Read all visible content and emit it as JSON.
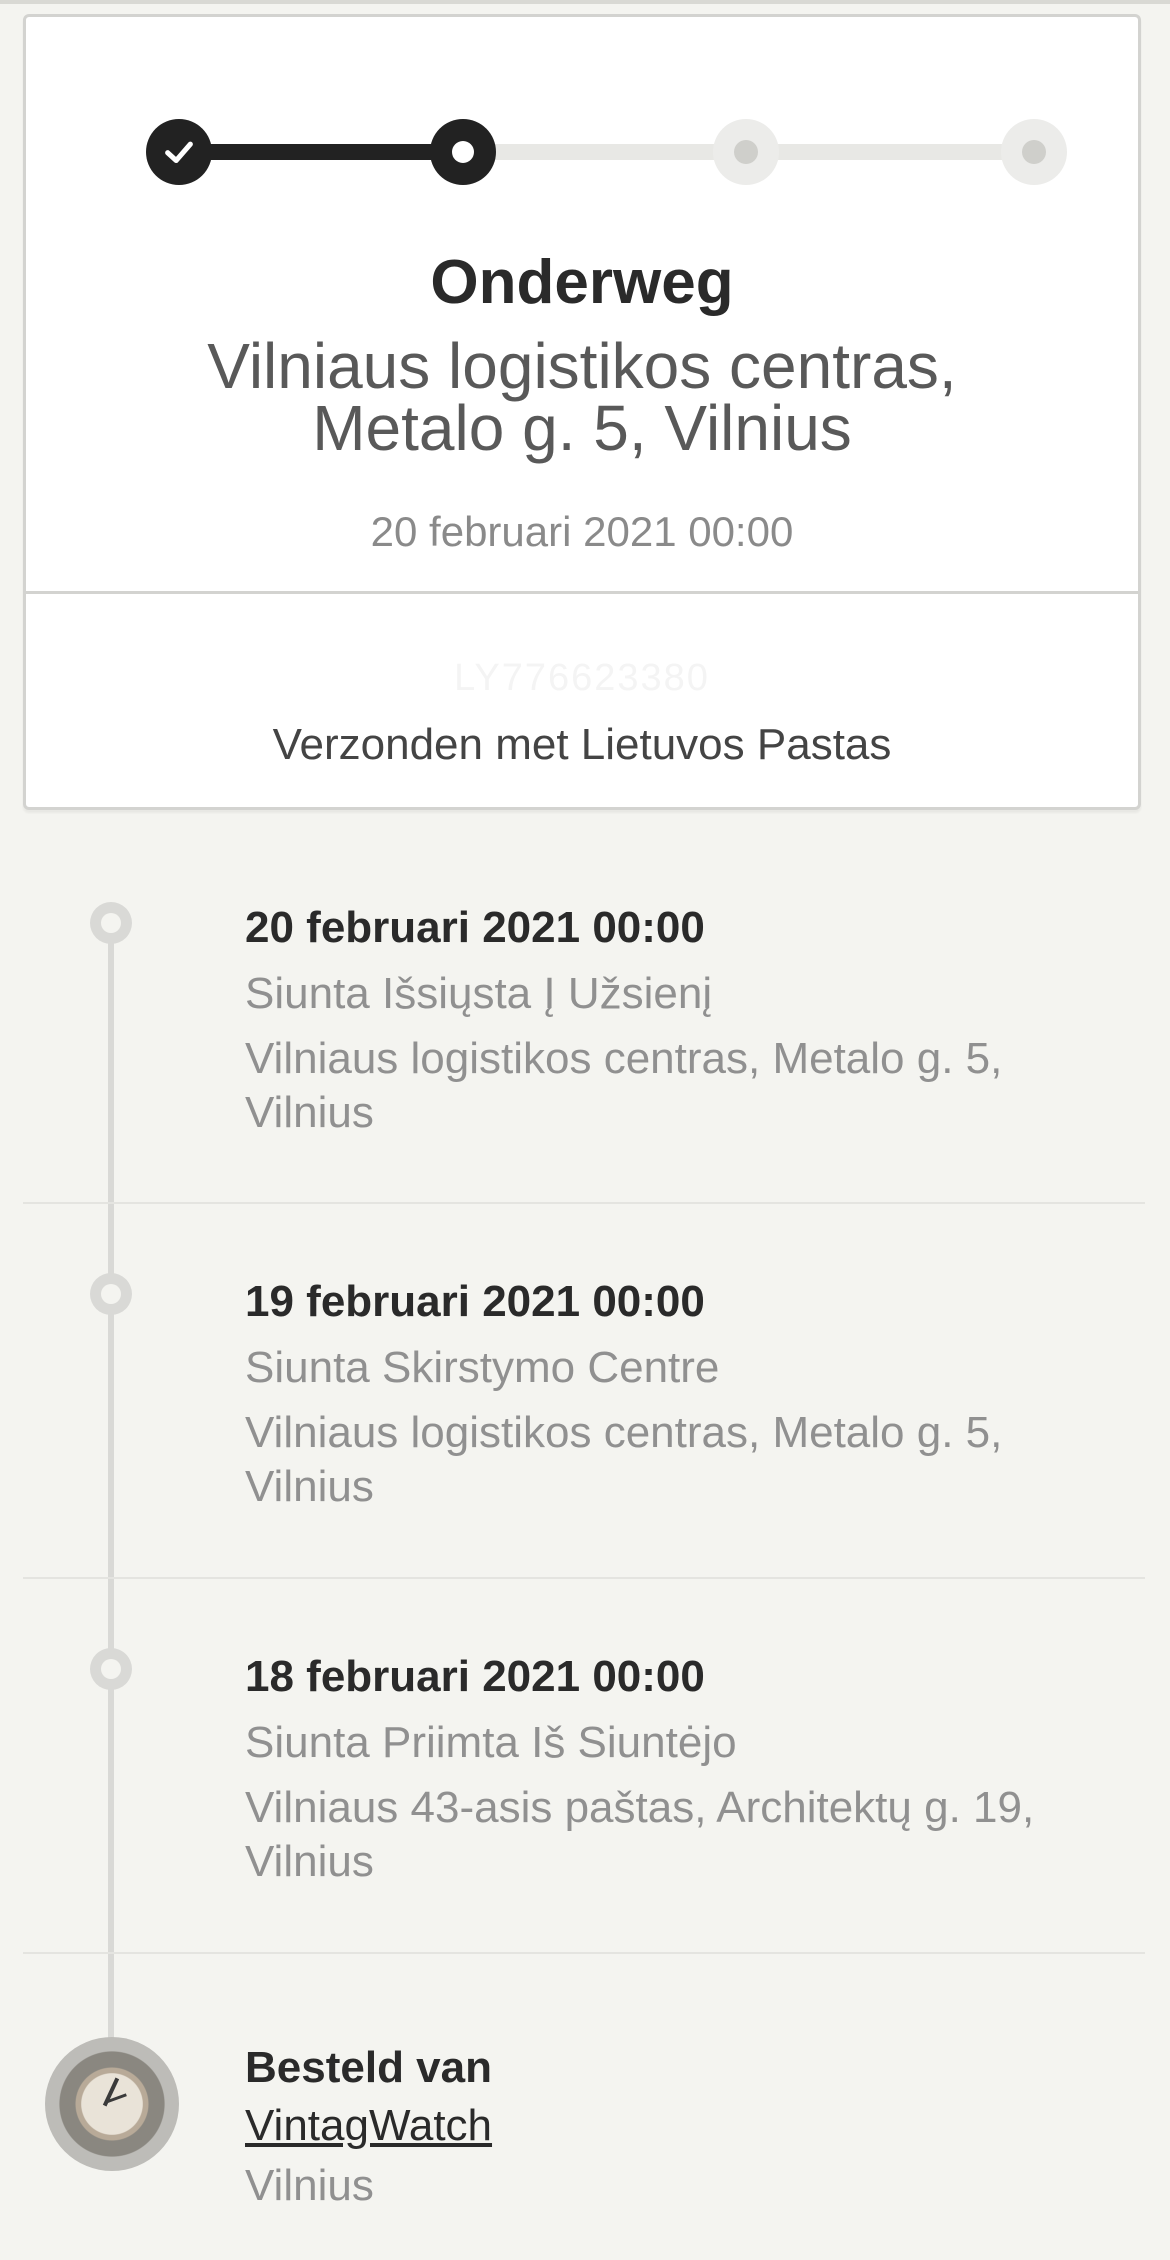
{
  "progress": {
    "steps": [
      "done",
      "current",
      "pending",
      "pending"
    ]
  },
  "status": {
    "title": "Onderweg",
    "location_line1": "Vilniaus logistikos centras,",
    "location_line2": "Metalo g. 5, Vilnius",
    "time": "20 februari 2021 00:00"
  },
  "shipment": {
    "tracking_number_faded": "LY776623380",
    "carrier_text": "Verzonden met Lietuvos Pastas"
  },
  "events": [
    {
      "date": "20 februari 2021 00:00",
      "status": "Siunta Išsiųsta Į Užsienį",
      "location": "Vilniaus logistikos centras, Metalo g. 5, Vilnius"
    },
    {
      "date": "19 februari 2021 00:00",
      "status": "Siunta Skirstymo Centre",
      "location": "Vilniaus logistikos centras, Metalo g. 5, Vilnius"
    },
    {
      "date": "18 februari 2021 00:00",
      "status": "Siunta Priimta Iš Siuntėjo",
      "location": "Vilniaus 43-asis paštas, Architektų g. 19, Vilnius"
    }
  ],
  "order": {
    "label": "Besteld van",
    "shop": "VintagWatch",
    "city": "Vilnius"
  },
  "colors": {
    "background": "#f4f4f0",
    "progress_done": "#222222",
    "progress_pending": "#e8e8e5",
    "muted_text": "#909090"
  }
}
